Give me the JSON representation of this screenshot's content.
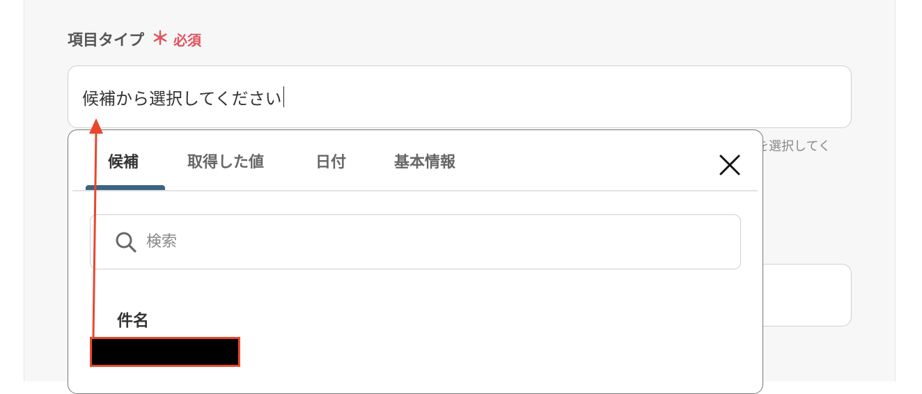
{
  "form": {
    "field_label": "項目タイプ",
    "required_mark": "＊",
    "required_text": "必須",
    "input_value": "候補から選択してください",
    "help_text": "を選択してく"
  },
  "dropdown": {
    "tabs": [
      {
        "label": "候補",
        "active": true
      },
      {
        "label": "取得した値",
        "active": false
      },
      {
        "label": "日付",
        "active": false
      },
      {
        "label": "基本情報",
        "active": false
      }
    ],
    "search_placeholder": "検索",
    "section_title": "件名",
    "items": [
      {
        "label": "",
        "redacted": true
      }
    ]
  },
  "icons": {
    "close": "close-icon",
    "search": "search-icon"
  },
  "colors": {
    "required": "#e0525c",
    "active_tab_underline": "#3c6380",
    "annotation": "#e8472b"
  }
}
